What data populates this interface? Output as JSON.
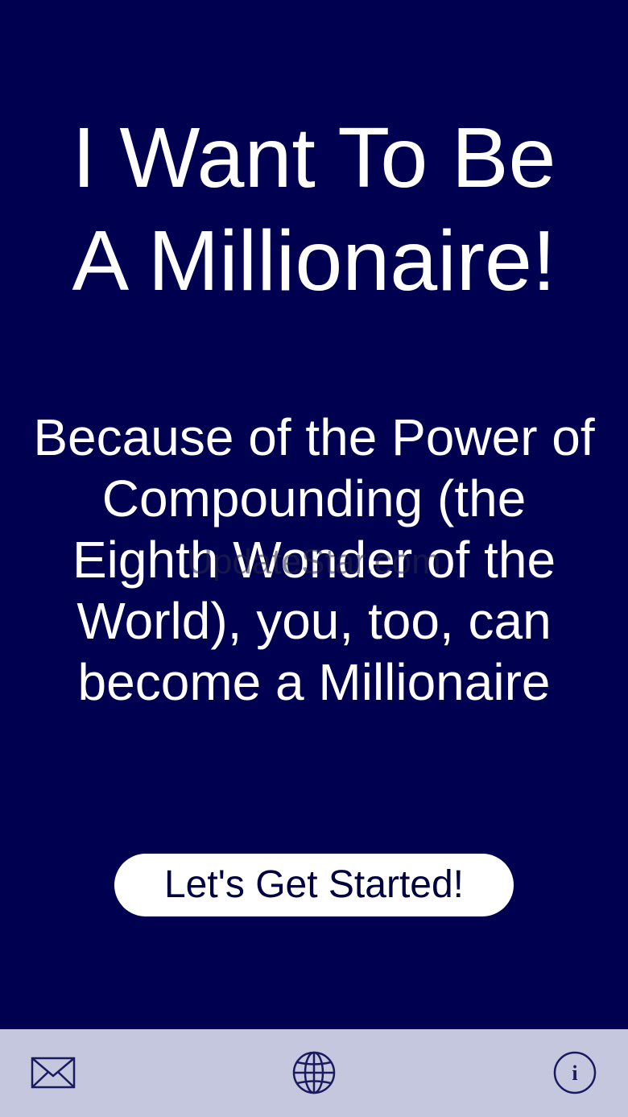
{
  "main": {
    "headline_line1": "I Want To Be",
    "headline_line2": "A Millionaire!",
    "tagline": "Because of the Power of Compounding (the Eighth Wonder of the World), you, too, can become a Millionaire",
    "watermark": "UpdateStar.com",
    "cta_label": "Let's Get Started!"
  },
  "tabbar": {
    "items": [
      {
        "icon": "mail-icon"
      },
      {
        "icon": "globe-icon"
      },
      {
        "icon": "info-icon",
        "glyph": "i"
      }
    ]
  },
  "colors": {
    "background": "#000050",
    "text": "#ffffff",
    "button_bg": "#ffffff",
    "button_text": "#000040",
    "tabbar_bg": "#c5c7de",
    "tabbar_icon": "#1a1a60"
  }
}
